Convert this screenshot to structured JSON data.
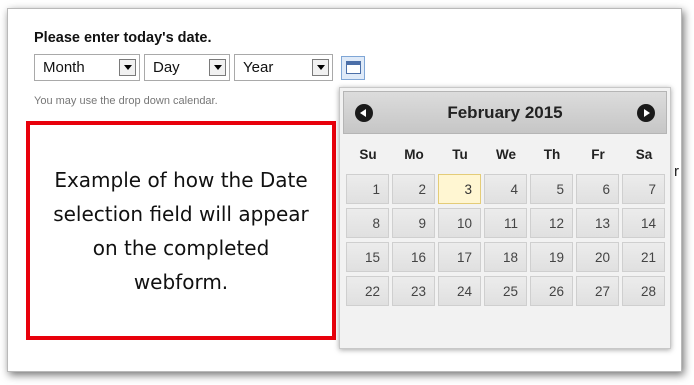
{
  "form": {
    "heading": "Please enter today's date.",
    "month": "Month",
    "day": "Day",
    "year": "Year",
    "hint": "You may use the drop down calendar.",
    "partial_text": "r"
  },
  "note": {
    "text": "Example of how the Date selection field will appear on the completed webform."
  },
  "calendar": {
    "title": "February 2015",
    "weekdays": [
      "Su",
      "Mo",
      "Tu",
      "We",
      "Th",
      "Fr",
      "Sa"
    ],
    "days": [
      "1",
      "2",
      "3",
      "4",
      "5",
      "6",
      "7",
      "8",
      "9",
      "10",
      "11",
      "12",
      "13",
      "14",
      "15",
      "16",
      "17",
      "18",
      "19",
      "20",
      "21",
      "22",
      "23",
      "24",
      "25",
      "26",
      "27",
      "28"
    ],
    "highlighted_day": "3"
  },
  "icons": {
    "dropdown": "chevron-down-icon",
    "calendar": "calendar-icon",
    "prev": "arrow-left-icon",
    "next": "arrow-right-icon"
  },
  "colors": {
    "callout_border": "#e8000b",
    "today_highlight": "#fff6d2"
  }
}
